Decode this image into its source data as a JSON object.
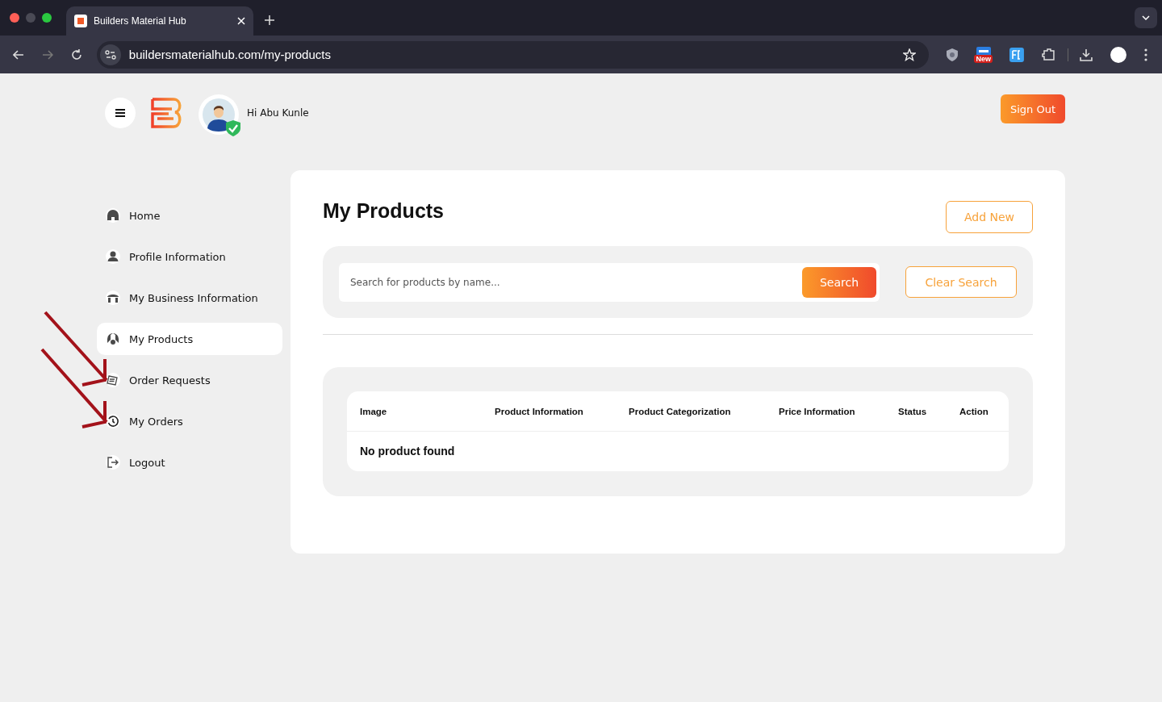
{
  "browser": {
    "tab_title": "Builders Material Hub",
    "url": "buildersmaterialhub.com/my-products",
    "extension_badge": "New"
  },
  "header": {
    "greeting": "Hi Abu Kunle",
    "sign_out": "Sign Out"
  },
  "sidebar": {
    "items": [
      {
        "label": "Home",
        "kind": "home",
        "selected": false
      },
      {
        "label": "Profile Information",
        "kind": "profile",
        "selected": false
      },
      {
        "label": "My Business Information",
        "kind": "business",
        "selected": false
      },
      {
        "label": "My Products",
        "kind": "products",
        "selected": true
      },
      {
        "label": "Order Requests",
        "kind": "requests",
        "selected": false
      },
      {
        "label": "My Orders",
        "kind": "history",
        "selected": false
      },
      {
        "label": "Logout",
        "kind": "logout",
        "selected": false
      }
    ]
  },
  "main": {
    "title": "My Products",
    "add_new": "Add New",
    "search": {
      "placeholder": "Search for products by name...",
      "button": "Search",
      "clear": "Clear Search"
    },
    "table": {
      "columns": [
        "Image",
        "Product Information",
        "Product Categorization",
        "Price Information",
        "Status",
        "Action"
      ],
      "empty_message": "No product found"
    }
  }
}
